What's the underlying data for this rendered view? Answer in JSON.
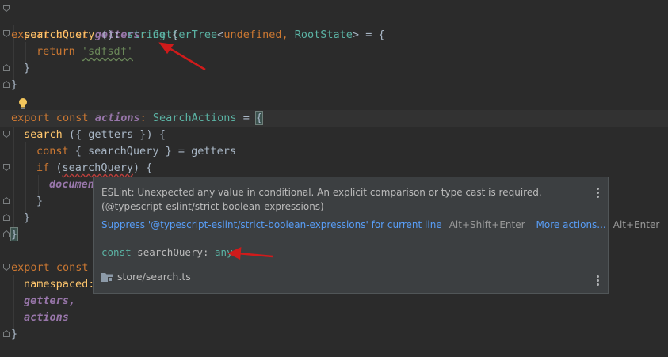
{
  "code": {
    "l1": {
      "export": "export",
      "const": "const",
      "name": "getters",
      "colon": ":",
      "type": "GetterTree",
      "lt": "<",
      "arg1": "undefined",
      "comma": ",",
      "arg2": "RootState",
      "gt": ">",
      "eq": "=",
      "brace": "{"
    },
    "l2": {
      "fn": "searchQuery",
      "paren": "():",
      "type": "string",
      "brace": "{"
    },
    "l3": {
      "ret": "return",
      "str": "'sdfsdf'"
    },
    "l4": "}",
    "l5": "}",
    "l7": {
      "export": "export",
      "const": "const",
      "name": "actions",
      "colon": ":",
      "type": "SearchActions",
      "eq": "=",
      "brace": "{"
    },
    "l8": {
      "fn": "search",
      "args": "({ getters }) {"
    },
    "l9": {
      "const": "const",
      "rest": "{ searchQuery } = getters"
    },
    "l10": {
      "if": "if",
      "open": "(",
      "arg": "searchQuery",
      "close": ") {"
    },
    "l11": "documen",
    "l12": "}",
    "l13": "}",
    "l14": "}",
    "l16": {
      "export": "export",
      "const": "const"
    },
    "l17": "namespaced:",
    "l18": "getters,",
    "l19": "actions",
    "l20": "}"
  },
  "popup": {
    "message": "ESLint: Unexpected any value in conditional. An explicit comparison or type cast is required.(@typescript-eslint/strict-boolean-expressions)",
    "suppress_link": "Suppress '@typescript-eslint/strict-boolean-expressions' for current line",
    "suppress_shortcut": "Alt+Shift+Enter",
    "more_actions_link": "More actions...",
    "more_actions_shortcut": "Alt+Enter",
    "signature_kw": "const",
    "signature_name": "searchQuery:",
    "signature_type": "any",
    "file_path": "store/search.ts"
  },
  "icons": {
    "bulb": "lightbulb-icon",
    "folder": "folder-icon",
    "kebab": "more-vertical-icon"
  },
  "colors": {
    "keyword": "#cc7832",
    "type": "#5bb3a4",
    "italic_prop": "#9876aa",
    "string": "#6a8759",
    "link": "#589df6",
    "annotation_arrow": "#d01b1b"
  }
}
